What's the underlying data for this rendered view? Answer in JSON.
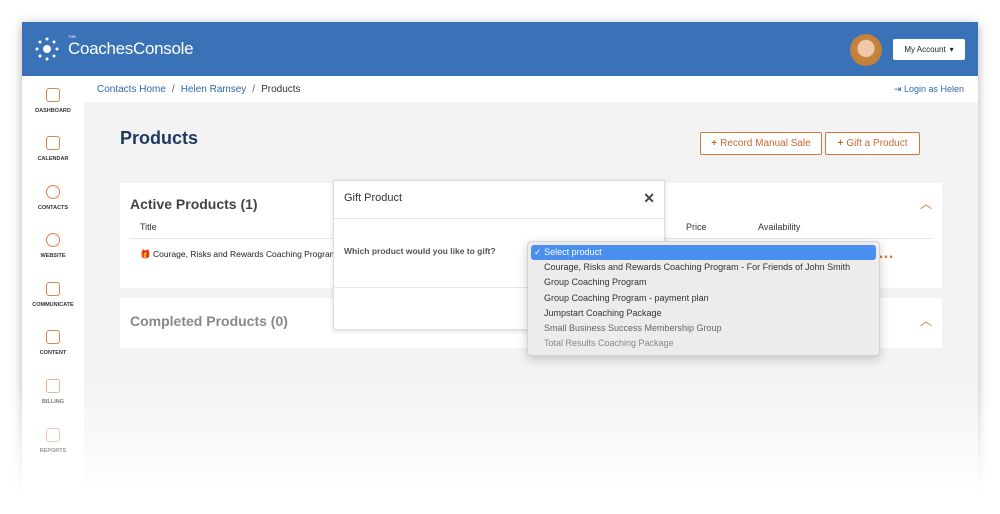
{
  "header": {
    "brand_small": "THE",
    "brand": "CoachesConsole",
    "account_label": "My Account"
  },
  "sidebar": {
    "items": [
      {
        "label": "DASHBOARD",
        "icon": "home-icon"
      },
      {
        "label": "CALENDAR",
        "icon": "calendar-icon"
      },
      {
        "label": "CONTACTS",
        "icon": "contacts-icon"
      },
      {
        "label": "WEBSITE",
        "icon": "compass-icon"
      },
      {
        "label": "COMMUNICATE",
        "icon": "send-icon"
      },
      {
        "label": "CONTENT",
        "icon": "document-icon"
      },
      {
        "label": "BILLING",
        "icon": "cart-icon"
      },
      {
        "label": "REPORTS",
        "icon": "chart-icon"
      }
    ]
  },
  "breadcrumb": {
    "items": [
      "Contacts Home",
      "Helen Ramsey",
      "Products"
    ],
    "login_as": "Login as Helen"
  },
  "page": {
    "title": "Products",
    "record_sale": "Record Manual Sale",
    "gift_product": "Gift a Product"
  },
  "active": {
    "heading": "Active Products (1)",
    "columns": [
      "Title",
      "Price",
      "Availability"
    ],
    "rows": [
      {
        "title": "Courage, Risks and Rewards Coaching Program"
      }
    ]
  },
  "completed": {
    "heading": "Completed Products (0)"
  },
  "modal": {
    "title": "Gift Product",
    "question": "Which product would you like to gift?"
  },
  "dropdown": {
    "options": [
      "Select product",
      "Courage, Risks and Rewards Coaching Program - For Friends of John Smith",
      "Group Coaching Program",
      "Group Coaching Program - payment plan",
      "Jumpstart Coaching Package",
      "Small Business Success Membership Group",
      "Total Results Coaching Package"
    ],
    "selected": "Select product"
  },
  "colors": {
    "header": "#3a72b8",
    "accent": "#d0793e",
    "select_highlight": "#4a8ef0"
  }
}
